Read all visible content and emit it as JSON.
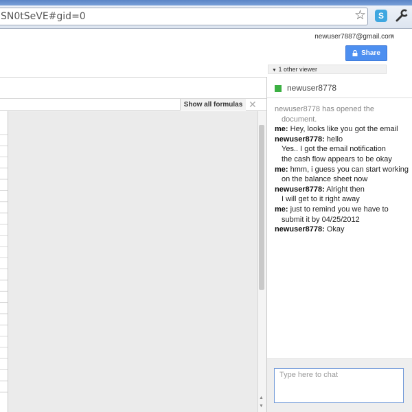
{
  "browser": {
    "url": "SN0tSeVE#gid=0",
    "icons": [
      "star-icon",
      "skype-extension-icon",
      "wrench-icon"
    ]
  },
  "header": {
    "account_email": "newuser7887@gmail.com",
    "share_label": "Share",
    "viewers_label": "1 other viewer"
  },
  "toolbar": {
    "show_formulas_label": "Show all formulas",
    "close_label": "✕"
  },
  "chat": {
    "user_name": "newuser8778",
    "presence_color": "#3cb043",
    "messages": [
      {
        "sender": "",
        "text": "newuser8778 has opened the document.",
        "system": true
      },
      {
        "sender": "me:",
        "text": "Hey, looks like you got the email"
      },
      {
        "sender": "newuser8778:",
        "text": "hello"
      },
      {
        "sender": "",
        "text": "Yes.. I got the email notification"
      },
      {
        "sender": "",
        "text": "the cash flow appears to be okay"
      },
      {
        "sender": "me:",
        "text": "hmm, i guess you can start working on the balance sheet now"
      },
      {
        "sender": "newuser8778:",
        "text": "Alright then"
      },
      {
        "sender": "",
        "text": "I will get to it right away"
      },
      {
        "sender": "me:",
        "text": "just to remind you we have to submit it by 04/25/2012"
      },
      {
        "sender": "newuser8778:",
        "text": "Okay"
      }
    ],
    "input_placeholder": "Type here to chat"
  },
  "colors": {
    "share_button": "#4d8ff0",
    "presence": "#3cb043"
  }
}
